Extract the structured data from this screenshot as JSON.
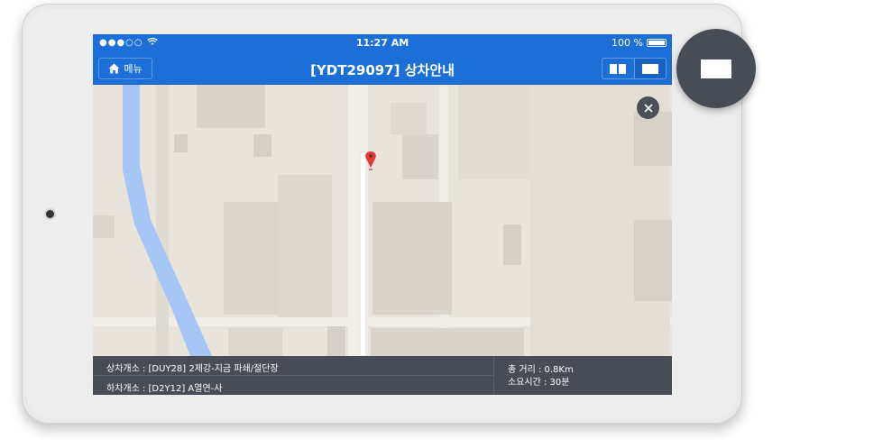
{
  "status_bar": {
    "signal": "●●●○○",
    "time": "11:27 AM",
    "battery": "100 %"
  },
  "nav": {
    "menu_label": "메뉴",
    "title": "[YDT29097] 상차안내"
  },
  "info": {
    "pickup": "상차개소 : [DUY28] 2제강-지금 파쇄/절단장",
    "dropoff": "하차개소 : [D2Y12] A열연-사",
    "distance": "총 거리 : 0.8Km",
    "duration": "소요시간 : 30분"
  },
  "colors": {
    "header_blue": "#1c6fd6",
    "info_bar": "#474c55",
    "route": "#ffffff",
    "canal": "#a6c6f6",
    "marker": "#e53935"
  },
  "icons": {
    "home": "home-icon",
    "split_view": "split-view-icon",
    "single_view": "single-view-icon",
    "close": "close-icon",
    "marker": "map-marker-icon",
    "wifi": "wifi-icon",
    "battery": "battery-icon"
  }
}
